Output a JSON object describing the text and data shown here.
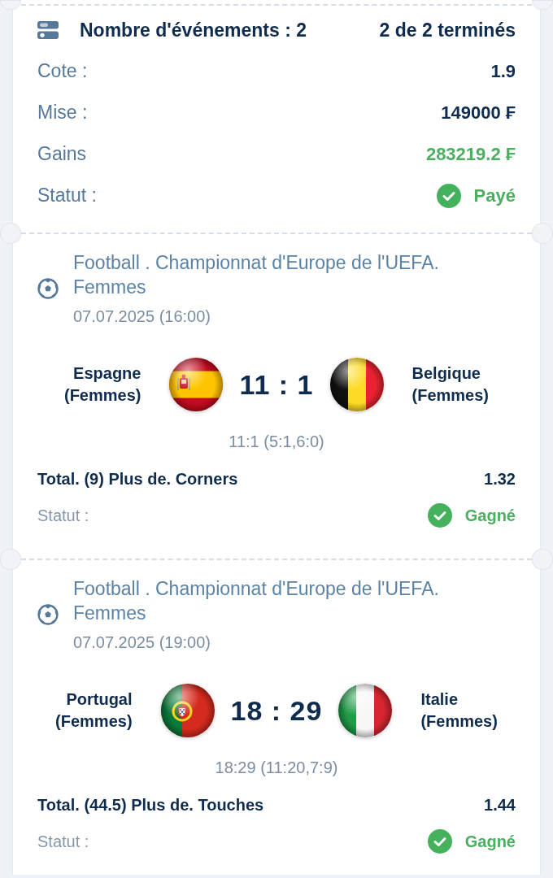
{
  "summary": {
    "title": "Nombre d'événements : 2",
    "progress": "2 de 2 terminés",
    "rows": [
      {
        "kind": "plain",
        "label": "Cote :",
        "value": "1.9"
      },
      {
        "kind": "plain",
        "label": "Mise :",
        "value": "149000 ₣"
      },
      {
        "kind": "gain",
        "label": "Gains",
        "value": "283219.2 ₣"
      },
      {
        "kind": "status",
        "label": "Statut :",
        "value": "Payé"
      }
    ]
  },
  "events": [
    {
      "league": "Football . Championnat d'Europe de l'UEFA. Femmes",
      "datetime": "07.07.2025 (16:00)",
      "home": {
        "name": "Espagne (Femmes)",
        "kind": "spain"
      },
      "score": "11 : 1",
      "away": {
        "name": "Belgique (Femmes)",
        "kind": "belgium"
      },
      "score_detail": "11:1 (5:1,6:0)",
      "bet": "Total. (9) Plus de. Corners",
      "odds": "1.32",
      "status_label": "Statut :",
      "status": "Gagné"
    },
    {
      "league": "Football . Championnat d'Europe de l'UEFA. Femmes",
      "datetime": "07.07.2025 (19:00)",
      "home": {
        "name": "Portugal (Femmes)",
        "kind": "portugal"
      },
      "score": "18 : 29",
      "away": {
        "name": "Italie (Femmes)",
        "kind": "italy"
      },
      "score_detail": "18:29 (11:20,7:9)",
      "bet": "Total. (44.5) Plus de. Touches",
      "odds": "1.44",
      "status_label": "Statut :",
      "status": "Gagné"
    }
  ]
}
